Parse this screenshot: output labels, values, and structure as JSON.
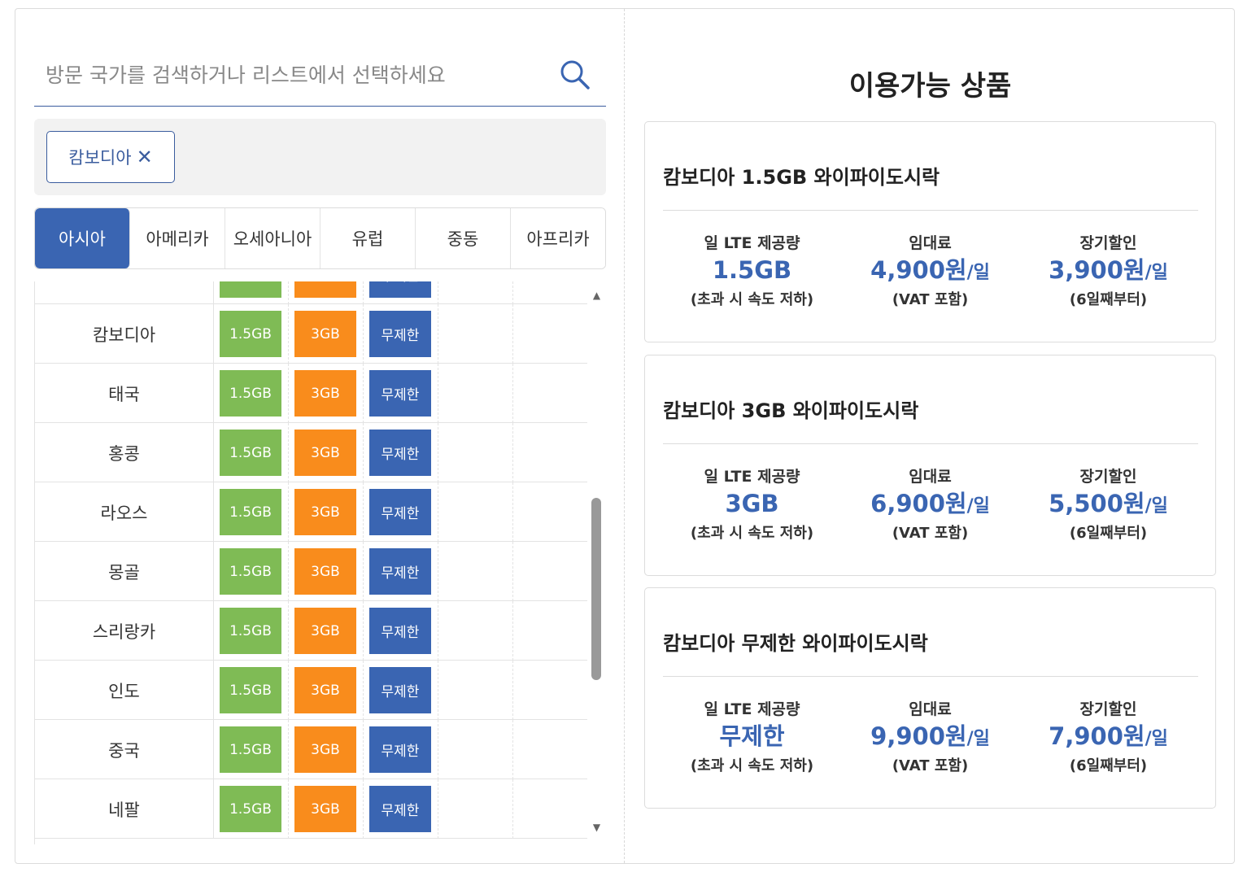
{
  "search": {
    "placeholder": "방문 국가를 검색하거나 리스트에서 선택하세요",
    "icon": "search-icon"
  },
  "selected": {
    "chip_label": "캄보디아",
    "remove_symbol": "✕"
  },
  "tabs": [
    {
      "label": "아시아",
      "active": true
    },
    {
      "label": "아메리카",
      "active": false
    },
    {
      "label": "오세아니아",
      "active": false
    },
    {
      "label": "유럽",
      "active": false
    },
    {
      "label": "중동",
      "active": false
    },
    {
      "label": "아프리카",
      "active": false
    }
  ],
  "plan_labels": {
    "p1": "1.5GB",
    "p2": "3GB",
    "p3": "무제한"
  },
  "countries": [
    "캄보디아",
    "태국",
    "홍콩",
    "라오스",
    "몽골",
    "스리랑카",
    "인도",
    "중국",
    "네팔"
  ],
  "colors": {
    "green": "#7fbb55",
    "orange": "#f98c1c",
    "blue": "#3a65b2"
  },
  "panel": {
    "title": "이용가능 상품",
    "col_labels": {
      "data": "일 LTE 제공량",
      "fee": "임대료",
      "discount": "장기할인"
    },
    "cards": [
      {
        "title": "캄보디아 1.5GB 와이파이도시락",
        "data": "1.5GB",
        "data_note": "(초과 시 속도 저하)",
        "fee": "4,900원",
        "fee_unit": "/일",
        "fee_note": "(VAT 포함)",
        "discount": "3,900원",
        "discount_unit": "/일",
        "discount_note": "(6일째부터)"
      },
      {
        "title": "캄보디아 3GB 와이파이도시락",
        "data": "3GB",
        "data_note": "(초과 시 속도 저하)",
        "fee": "6,900원",
        "fee_unit": "/일",
        "fee_note": "(VAT 포함)",
        "discount": "5,500원",
        "discount_unit": "/일",
        "discount_note": "(6일째부터)"
      },
      {
        "title": "캄보디아 무제한 와이파이도시락",
        "data": "무제한",
        "data_note": "(초과 시 속도 저하)",
        "fee": "9,900원",
        "fee_unit": "/일",
        "fee_note": "(VAT 포함)",
        "discount": "7,900원",
        "discount_unit": "/일",
        "discount_note": "(6일째부터)"
      }
    ]
  }
}
